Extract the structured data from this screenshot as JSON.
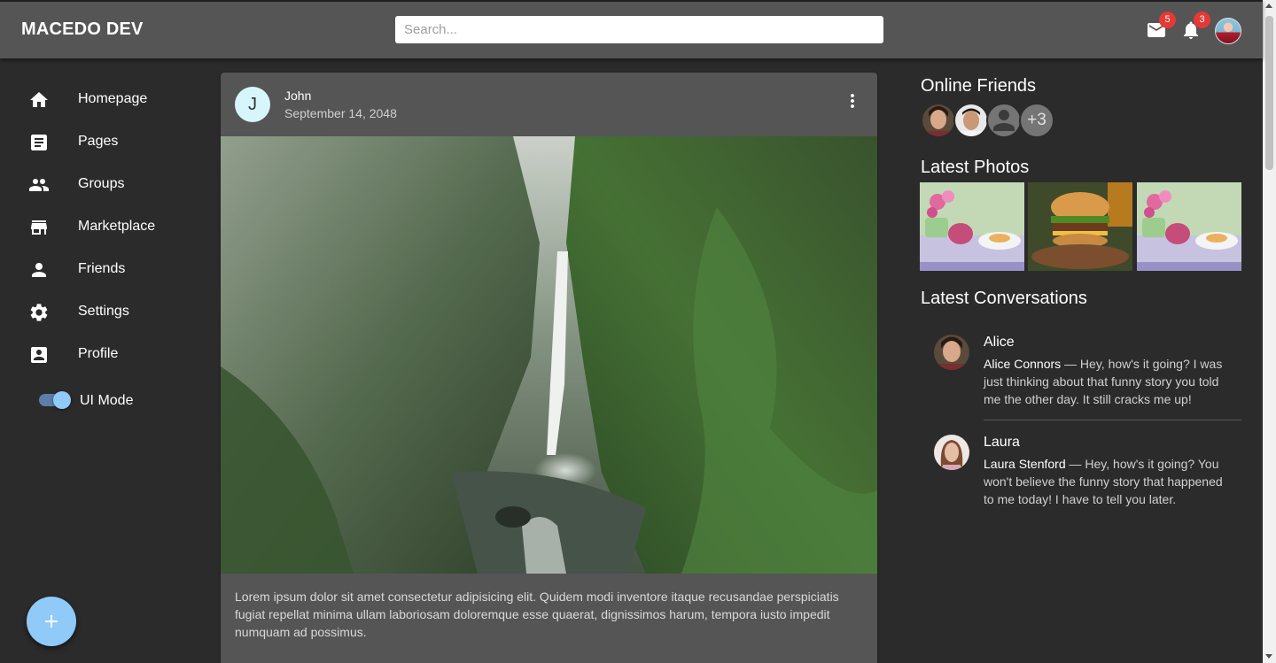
{
  "app": {
    "brand": "MACEDO DEV"
  },
  "search": {
    "placeholder": "Search..."
  },
  "header": {
    "mail_badge": "5",
    "notifications_badge": "3",
    "mail_icon": "mail-icon",
    "notifications_icon": "bell-icon"
  },
  "sidebar": {
    "items": [
      {
        "label": "Homepage",
        "icon": "home-icon"
      },
      {
        "label": "Pages",
        "icon": "article-icon"
      },
      {
        "label": "Groups",
        "icon": "people-icon"
      },
      {
        "label": "Marketplace",
        "icon": "storefront-icon"
      },
      {
        "label": "Friends",
        "icon": "person-icon"
      },
      {
        "label": "Settings",
        "icon": "gear-icon"
      },
      {
        "label": "Profile",
        "icon": "account-box-icon"
      }
    ],
    "ui_mode_label": "UI Mode",
    "ui_mode_on": true
  },
  "fab": {
    "label": "+"
  },
  "post": {
    "avatar_letter": "J",
    "author": "John",
    "date": "September 14, 2048",
    "text": "Lorem ipsum dolor sit amet consectetur adipisicing elit. Quidem modi inventore itaque recusandae perspiciatis fugiat repellat minima ullam laboriosam doloremque esse quaerat, dignissimos harum, tempora iusto impedit numquam ad possimus."
  },
  "right": {
    "online_friends_title": "Online Friends",
    "online_more": "+3",
    "latest_photos_title": "Latest Photos",
    "latest_conversations_title": "Latest Conversations",
    "conversations": [
      {
        "name": "Alice",
        "sender": "Alice Connors",
        "text": " — Hey, how's it going? I was just thinking about that funny story you told me the other day. It still cracks me up!"
      },
      {
        "name": "Laura",
        "sender": "Laura Stenford",
        "text": " — Hey, how's it going? You won't believe the funny story that happened to me today! I have to tell you later."
      }
    ]
  },
  "colors": {
    "appbar": "#555555",
    "background": "#2b2b2b",
    "card": "#555555",
    "accent": "#90caf9",
    "badge": "#e53935"
  }
}
